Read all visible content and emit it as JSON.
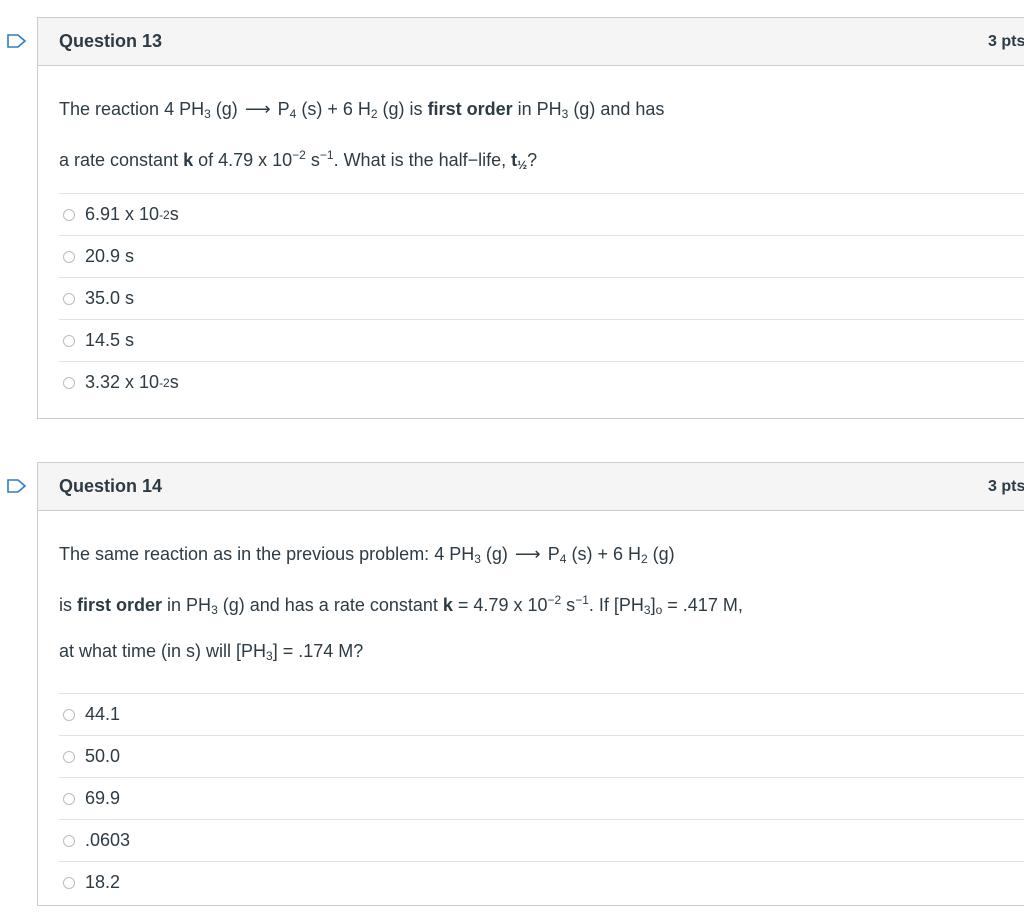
{
  "colors": {
    "flag": "#2d7cc4",
    "border": "#c7cdd1",
    "header_bg": "#f5f5f5",
    "text": "#2d3b45"
  },
  "q13": {
    "title": "Question 13",
    "points": "3 pts",
    "text": {
      "intro": "The reaction",
      "reactant": "4 PH",
      "reactant_sub": "3",
      "reactant_state": " (g)",
      "arrow": "⟶",
      "product1": "P",
      "product1_sub": "4",
      "product1_state": " (s)  +  6 H",
      "product2_sub": "2",
      "product2_state": " (g)  is",
      "bold1": "first order",
      "mid": " in PH",
      "mid_sub": "3",
      "end1": " (g) and has",
      "line2_a": "a rate constant ",
      "k": "k",
      "line2_b": " of 4.79 x 10",
      "exp1": "−2",
      "line2_c": " s",
      "exp2": "−1",
      "line2_d": ".  What is the half−life, ",
      "t": "t",
      "t_sub": "½",
      "q": "?"
    },
    "answers": [
      {
        "base": "6.91 x 10",
        "sup": "-2",
        "unit": " s"
      },
      {
        "base": "20.9 s",
        "sup": "",
        "unit": ""
      },
      {
        "base": "35.0 s",
        "sup": "",
        "unit": ""
      },
      {
        "base": "14.5 s",
        "sup": "",
        "unit": ""
      },
      {
        "base": "3.32 x 10",
        "sup": "-2",
        "unit": " s"
      }
    ]
  },
  "q14": {
    "title": "Question 14",
    "points": "3 pts",
    "text": {
      "l1a": "The same reaction as in the previous problem:  4 PH",
      "l1a_sub": "3",
      "l1b": " (g)",
      "arrow": "⟶",
      "l1c": "P",
      "l1c_sub": "4",
      "l1d": " (s)  +  6 H",
      "l1d_sub": "2",
      "l1e": " (g)",
      "l2a": "is ",
      "l2bold": "first order",
      "l2b": " in PH",
      "l2b_sub": "3",
      "l2c": " (g) and has a rate constant ",
      "l2k": "k",
      "l2d": " = 4.79 x 10",
      "l2exp1": "−2",
      "l2e": " s",
      "l2exp2": "−1",
      "l2f": ".  If [PH",
      "l2f_sub": "3",
      "l2g": "]",
      "l2g_sub": "o",
      "l2h": "  =  .417 M,",
      "l3a": "at what time (in s) will [PH",
      "l3a_sub": "3",
      "l3b": "]  =  .174 M?"
    },
    "answers": [
      "44.1",
      "50.0",
      "69.9",
      ".0603",
      "18.2"
    ]
  }
}
